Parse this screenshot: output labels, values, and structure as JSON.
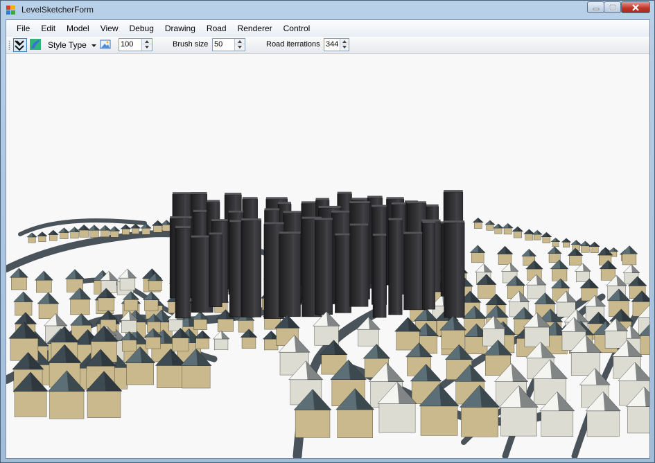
{
  "window": {
    "title": "LevelSketcherForm"
  },
  "menu": [
    {
      "label": "File"
    },
    {
      "label": "Edit"
    },
    {
      "label": "Model"
    },
    {
      "label": "View"
    },
    {
      "label": "Debug"
    },
    {
      "label": "Drawing"
    },
    {
      "label": "Road"
    },
    {
      "label": "Renderer"
    },
    {
      "label": "Control"
    }
  ],
  "toolbar": {
    "style_type_label": "Style Type",
    "style_value": "100",
    "brush_size_label": "Brush size",
    "brush_size_value": "50",
    "road_iterations_label": "Road iterrations",
    "road_iterations_value": "344"
  },
  "viewport": {
    "scene": "3d-city-render"
  },
  "colors": {
    "background": "#f8f8f8",
    "road": "#4a525a",
    "house_wall": "#c9b98d",
    "house_roof": "#3e4a52",
    "tower": "#2a2a2c"
  }
}
